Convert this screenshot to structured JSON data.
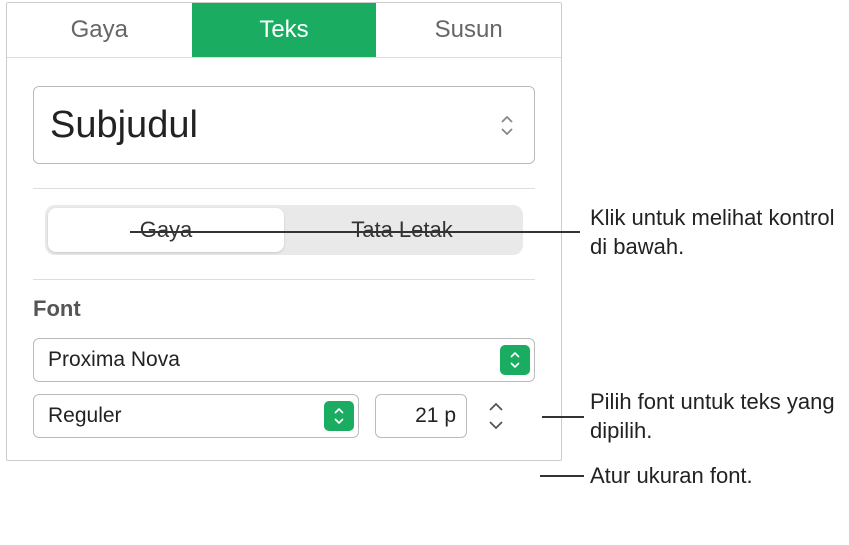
{
  "tabs": {
    "gaya": "Gaya",
    "teks": "Teks",
    "susun": "Susun"
  },
  "paragraphStyle": {
    "selected": "Subjudul"
  },
  "segmented": {
    "gaya": "Gaya",
    "tataLetak": "Tata Letak"
  },
  "font": {
    "sectionLabel": "Font",
    "family": "Proxima Nova",
    "weight": "Reguler",
    "size": "21 p"
  },
  "callouts": {
    "seeControls": "Klik untuk melihat kontrol di bawah.",
    "pickFont": "Pilih font untuk teks yang dipilih.",
    "setSize": "Atur ukuran font."
  }
}
